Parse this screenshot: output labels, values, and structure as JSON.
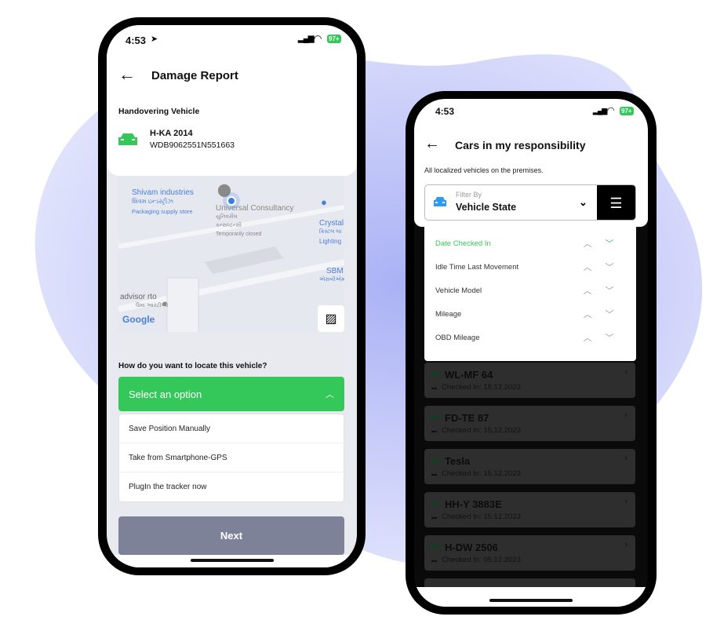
{
  "colors": {
    "accent_green": "#34c759",
    "next_button": "#7d8299",
    "blob": "#dfe1fb",
    "dark_card": "#2e2e2e"
  },
  "left_phone": {
    "status": {
      "time": "4:53",
      "battery": "97+"
    },
    "header": {
      "title": "Damage Report",
      "back_icon": "arrow-left-icon"
    },
    "vehicle": {
      "section_label": "Handovering Vehicle",
      "plate": "H-KA 2014",
      "vin": "WDB9062551N551663",
      "icon": "car-icon"
    },
    "map": {
      "labels": [
        "Shivam industries",
        "શિવમ ઇન્ડસ્ટ્રીઝ",
        "Packaging supply store",
        "Universal Consultancy",
        "યુનિવર્સલ",
        "કન્સલ્ટન્સી",
        "Temporarily closed",
        "Crystal",
        "ક્રિસ્ટલ લા",
        "Lighting",
        "SBM",
        "એસબીએમ",
        "advisor rto",
        "ઉમા આરટીઓ"
      ],
      "logo": "Google"
    },
    "locate": {
      "question": "How do you want to locate this vehicle?",
      "select_placeholder": "Select an option",
      "options": [
        "Save Position Manually",
        "Take from Smartphone-GPS",
        "PlugIn the tracker now"
      ]
    },
    "next_label": "Next"
  },
  "right_phone": {
    "status": {
      "time": "4:53",
      "battery": "97+"
    },
    "header": {
      "title": "Cars in my responsibility"
    },
    "subtitle": "All localized vehicles on the premises.",
    "filter": {
      "label": "Filter By",
      "value": "Vehicle State"
    },
    "sort_options": [
      {
        "label": "Date Checked In",
        "active": true
      },
      {
        "label": "Idle Time Last Movement",
        "active": false
      },
      {
        "label": "Vehicle Model",
        "active": false
      },
      {
        "label": "Mileage",
        "active": false
      },
      {
        "label": "OBD Mileage",
        "active": false
      }
    ],
    "cars": [
      {
        "plate": "WL-MF 64",
        "checked": "Checked In: 18.12.2023"
      },
      {
        "plate": "FD-TE 87",
        "checked": "Checked In: 15.12.2023"
      },
      {
        "plate": "Tesla",
        "checked": "Checked In: 15.12.2023"
      },
      {
        "plate": "HH-Y 3883E",
        "checked": "Checked In: 15.12.2023"
      },
      {
        "plate": "H-DW 2506",
        "checked": "Checked In: 05.12.2023"
      }
    ]
  }
}
